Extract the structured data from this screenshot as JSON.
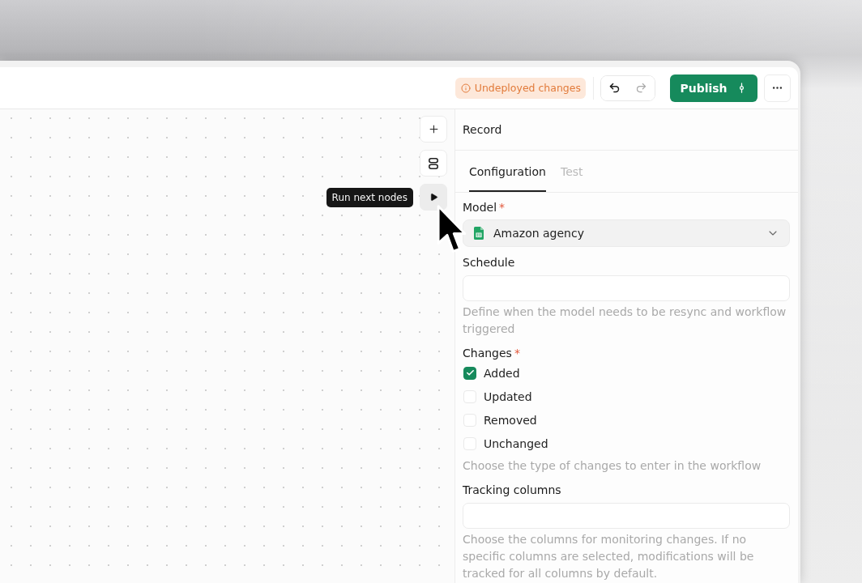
{
  "toolbar": {
    "status_badge": {
      "text": "Undeployed changes"
    },
    "history": [
      {
        "kind": "undo",
        "disabled": false
      },
      {
        "kind": "redo",
        "disabled": true
      }
    ],
    "publish": {
      "label": "Publish"
    }
  },
  "canvas": {
    "controls": [
      {
        "kind": "add",
        "hovered": false
      },
      {
        "kind": "layout",
        "hovered": false
      },
      {
        "kind": "run",
        "hovered": true,
        "tooltip": "Run next nodes"
      }
    ]
  },
  "panel": {
    "title": "Record",
    "tabs": [
      {
        "label": "Configuration",
        "selected": true
      },
      {
        "label": "Test",
        "selected": false
      }
    ],
    "fields": [
      {
        "kind": "select",
        "label": "Model",
        "required_mark": "*",
        "value": "Amazon agency"
      },
      {
        "kind": "text",
        "label": "Schedule",
        "help": "Define when the model needs to be resync and workflow triggered"
      },
      {
        "kind": "checkboxes",
        "label": "Changes",
        "required_mark": "*",
        "options": [
          {
            "label": "Added",
            "checked": true
          },
          {
            "label": "Updated",
            "checked": false
          },
          {
            "label": "Removed",
            "checked": false
          },
          {
            "label": "Unchanged",
            "checked": false
          }
        ],
        "help": "Choose the type of changes to enter in the workflow"
      },
      {
        "kind": "text",
        "label": "Tracking columns",
        "help": "Choose the columns for monitoring changes. If no specific columns are selected, modifications will be tracked for all columns by default."
      }
    ]
  }
}
